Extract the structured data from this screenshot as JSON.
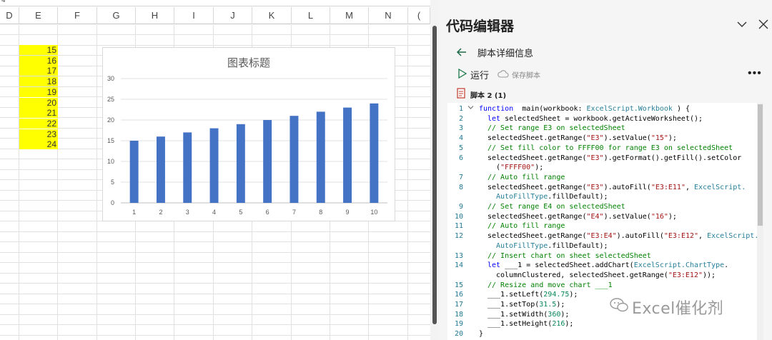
{
  "sheet": {
    "top_cell_ref": "4",
    "columns": [
      "D",
      "E",
      "F",
      "G",
      "H",
      "I",
      "J",
      "K",
      "L",
      "M",
      "N",
      "O"
    ],
    "column_display": [
      "D",
      "E",
      "F",
      "G",
      "H",
      "I",
      "J",
      "K",
      "L",
      "M",
      "N",
      "("
    ],
    "e_values": [
      "15",
      "16",
      "17",
      "18",
      "19",
      "20",
      "21",
      "22",
      "23",
      "24"
    ],
    "fill_color": "#FFFF00"
  },
  "chart_data": {
    "type": "bar",
    "title": "图表标题",
    "categories": [
      "1",
      "2",
      "3",
      "4",
      "5",
      "6",
      "7",
      "8",
      "9",
      "10"
    ],
    "series": [
      {
        "values": [
          15,
          16,
          17,
          18,
          19,
          20,
          21,
          22,
          23,
          24
        ]
      }
    ],
    "yticks": [
      "0",
      "5",
      "10",
      "15",
      "20",
      "25",
      "30"
    ],
    "ylim": [
      0,
      30
    ],
    "grid": true,
    "bar_color": "#4472C4"
  },
  "pane": {
    "title": "代码编辑器",
    "detail_title": "脚本详细信息",
    "run_label": "运行",
    "save_label": "保存脚本",
    "more_label": "•••",
    "script_name": "脚本 2 (1)"
  },
  "code": {
    "line_numbers": [
      "1",
      "2",
      "3",
      "4",
      "5",
      "6",
      "",
      "7",
      "8",
      "",
      "9",
      "10",
      "11",
      "12",
      "",
      "13",
      "14",
      "",
      "15",
      "16",
      "17",
      "18",
      "19",
      "20"
    ],
    "lines": [
      [
        [
          "kw",
          "function"
        ],
        [
          "",
          "  main(workbook: "
        ],
        [
          "typ",
          "ExcelScript.Workbook"
        ],
        [
          "",
          " ) {"
        ]
      ],
      [
        [
          "kw",
          "let"
        ],
        [
          "",
          " selectedSheet = workbook.getActiveWorksheet();"
        ]
      ],
      [
        [
          "cmt",
          "// Set range E3 on selectedSheet"
        ]
      ],
      [
        [
          "",
          "selectedSheet.getRange("
        ],
        [
          "str",
          "\"E3\""
        ],
        [
          "",
          ").setValue("
        ],
        [
          "str",
          "\"15\""
        ],
        [
          "",
          ");"
        ]
      ],
      [
        [
          "cmt",
          "// Set fill color to FFFF00 for range E3 on selectedSheet"
        ]
      ],
      [
        [
          "",
          "selectedSheet.getRange("
        ],
        [
          "str",
          "\"E3\""
        ],
        [
          "",
          ").getFormat().getFill().setColor"
        ]
      ],
      [
        [
          "",
          "("
        ],
        [
          "str",
          "\"FFFF00\""
        ],
        [
          "",
          ");"
        ]
      ],
      [
        [
          "cmt",
          "// Auto fill range"
        ]
      ],
      [
        [
          "",
          "selectedSheet.getRange("
        ],
        [
          "str",
          "\"E3\""
        ],
        [
          "",
          ").autoFill("
        ],
        [
          "str",
          "\"E3:E11\""
        ],
        [
          "",
          ", "
        ],
        [
          "typ",
          "ExcelScript."
        ]
      ],
      [
        [
          "typ",
          "AutoFillType"
        ],
        [
          "",
          ".fillDefault);"
        ]
      ],
      [
        [
          "cmt",
          "// Set range E4 on selectedSheet"
        ]
      ],
      [
        [
          "",
          "selectedSheet.getRange("
        ],
        [
          "str",
          "\"E4\""
        ],
        [
          "",
          ").setValue("
        ],
        [
          "str",
          "\"16\""
        ],
        [
          "",
          ");"
        ]
      ],
      [
        [
          "cmt",
          "// Auto fill range"
        ]
      ],
      [
        [
          "",
          "selectedSheet.getRange("
        ],
        [
          "str",
          "\"E3:E4\""
        ],
        [
          "",
          ").autoFill("
        ],
        [
          "str",
          "\"E3:E12\""
        ],
        [
          "",
          ", "
        ],
        [
          "typ",
          "ExcelScript."
        ]
      ],
      [
        [
          "typ",
          "AutoFillType"
        ],
        [
          "",
          ".fillDefault);"
        ]
      ],
      [
        [
          "cmt",
          "// Insert chart on sheet selectedSheet"
        ]
      ],
      [
        [
          "kw",
          "let"
        ],
        [
          "",
          " ___1 = selectedSheet.addChart("
        ],
        [
          "typ",
          "ExcelScript.ChartType"
        ],
        [
          "",
          "."
        ]
      ],
      [
        [
          "",
          "columnClustered, selectedSheet.getRange("
        ],
        [
          "str",
          "\"E3:E12\""
        ],
        [
          "",
          "));"
        ]
      ],
      [
        [
          "cmt",
          "// Resize and move chart ___1"
        ]
      ],
      [
        [
          "",
          "___1.setLeft("
        ],
        [
          "num",
          "294.75"
        ],
        [
          "",
          ");"
        ]
      ],
      [
        [
          "",
          "___1.setTop("
        ],
        [
          "num",
          "31.5"
        ],
        [
          "",
          ");"
        ]
      ],
      [
        [
          "",
          "___1.setWidth("
        ],
        [
          "num",
          "360"
        ],
        [
          "",
          ");"
        ]
      ],
      [
        [
          "",
          "___1.setHeight("
        ],
        [
          "num",
          "216"
        ],
        [
          "",
          ");"
        ]
      ],
      [
        [
          "",
          "}"
        ]
      ]
    ]
  },
  "watermark": {
    "text": "Excel催化剂"
  }
}
